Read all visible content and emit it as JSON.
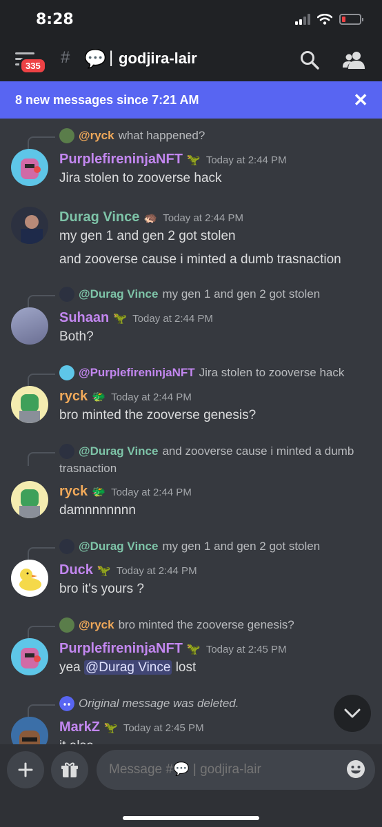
{
  "status": {
    "time": "8:28"
  },
  "header": {
    "badge": "335",
    "channel_icon": "💬",
    "separator": "|",
    "channel_name": "godjira-lair"
  },
  "banner": {
    "text": "8 new messages since 7:21 AM"
  },
  "messages": [
    {
      "reply_name": "@ryck",
      "reply_text": "what happened?",
      "author": "PurplefireninjaNFT",
      "time": "Today at 2:44 PM",
      "lines": [
        "Jira stolen to zooverse hack"
      ]
    },
    {
      "author": "Durag Vince",
      "time": "Today at 2:44 PM",
      "lines": [
        "my gen 1 and gen 2 got stolen",
        "and zooverse cause i minted a dumb trasnaction"
      ]
    },
    {
      "reply_name": "@Durag Vince",
      "reply_text": "my gen 1 and gen 2 got stolen",
      "author": "Suhaan",
      "time": "Today at 2:44 PM",
      "lines": [
        "Both?"
      ]
    },
    {
      "reply_name": "@PurplefireninjaNFT",
      "reply_text": "Jira stolen to zooverse hack",
      "author": "ryck",
      "time": "Today at 2:44 PM",
      "lines": [
        "bro minted the zooverse genesis?"
      ]
    },
    {
      "reply_name": "@Durag Vince",
      "reply_text": "and zooverse cause i minted a dumb",
      "reply_text_2": "trasnaction",
      "author": "ryck",
      "time": "Today at 2:44 PM",
      "lines": [
        "damnnnnnnn"
      ]
    },
    {
      "reply_name": "@Durag Vince",
      "reply_text": "my gen 1 and gen 2 got stolen",
      "author": "Duck",
      "time": "Today at 2:44 PM",
      "lines": [
        "bro it's yours ?"
      ]
    },
    {
      "reply_name": "@ryck",
      "reply_text": "bro minted the zooverse genesis?",
      "author": "PurplefireninjaNFT",
      "time": "Today at 2:45 PM",
      "line_prefix": "yea",
      "mention": "@Durag Vince",
      "line_suffix": "lost"
    },
    {
      "reply_text": "Original message was deleted.",
      "author": "MarkZ",
      "time": "Today at 2:45 PM",
      "lines": [
        "it also"
      ]
    }
  ],
  "composer": {
    "placeholder": "Message #💬 | godjira-lair"
  },
  "colors": {
    "accent": "#5865f2",
    "background": "#36393f",
    "header": "#202225",
    "name_purple": "#c387f0",
    "name_green": "#7ec4a8",
    "name_orange": "#f0a95a"
  },
  "icons": [
    "hamburger-menu-icon",
    "hash-lock-icon",
    "search-icon",
    "members-icon",
    "close-icon",
    "chevron-down-icon",
    "plus-icon",
    "gift-icon",
    "emoji-icon",
    "discord-logo-icon"
  ]
}
